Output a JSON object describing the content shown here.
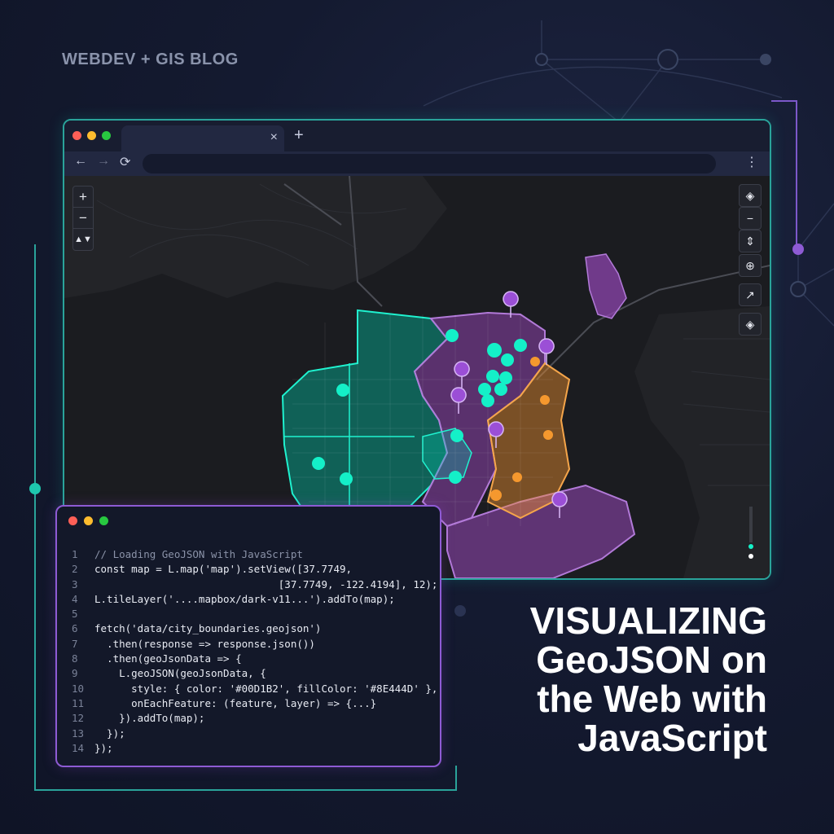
{
  "blog_label": "WEBDEV + GIS BLOG",
  "colors": {
    "teal": "#00D1B2",
    "purple": "#8E44AD",
    "orange": "#F0912E",
    "background": "#141a30"
  },
  "browser": {
    "tab_close": "×",
    "new_tab": "+",
    "nav": {
      "back": "←",
      "forward": "→",
      "reload": "⟳",
      "menu": "⋮"
    }
  },
  "map": {
    "zoom": {
      "in": "+",
      "out": "−",
      "compass": "▲▼"
    },
    "right_controls": [
      "layers-icon",
      "minus-icon",
      "compass-icon",
      "add-icon",
      "arrow-icon",
      "layers-icon"
    ],
    "right_glyphs": {
      "layers": "◈",
      "minus": "−",
      "compass": "⇕",
      "add": "⊕",
      "arrow": "↗",
      "layers2": "◈"
    }
  },
  "code": {
    "lines": [
      {
        "n": "1",
        "text": "// Loading GeoJSON with JavaScript",
        "comment": true
      },
      {
        "n": "2",
        "text": "const map = L.map('map').setView([37.7749,",
        "comment": false
      },
      {
        "n": "3",
        "text": "                              [37.7749, -122.4194], 12);",
        "comment": false
      },
      {
        "n": "4",
        "text": "L.tileLayer('....mapbox/dark-v11...').addTo(map);",
        "comment": false
      },
      {
        "n": "5",
        "text": "",
        "comment": false
      },
      {
        "n": "6",
        "text": "fetch('data/city_boundaries.geojson')",
        "comment": false
      },
      {
        "n": "7",
        "text": "  .then(response => response.json())",
        "comment": false
      },
      {
        "n": "8",
        "text": "  .then(geoJsonData => {",
        "comment": false
      },
      {
        "n": "9",
        "text": "    L.geoJSON(geoJsonData, {",
        "comment": false
      },
      {
        "n": "10",
        "text": "      style: { color: '#00D1B2', fillColor: '#8E444D' },",
        "comment": false
      },
      {
        "n": "11",
        "text": "      onEachFeature: (feature, layer) => {...}",
        "comment": false
      },
      {
        "n": "12",
        "text": "    }).addTo(map);",
        "comment": false
      },
      {
        "n": "13",
        "text": "  });",
        "comment": false
      },
      {
        "n": "14",
        "text": "});",
        "comment": false
      }
    ]
  },
  "title_lines": [
    "VISUALIZING",
    "GeoJSON on",
    "the Web with",
    "JavaScript"
  ]
}
